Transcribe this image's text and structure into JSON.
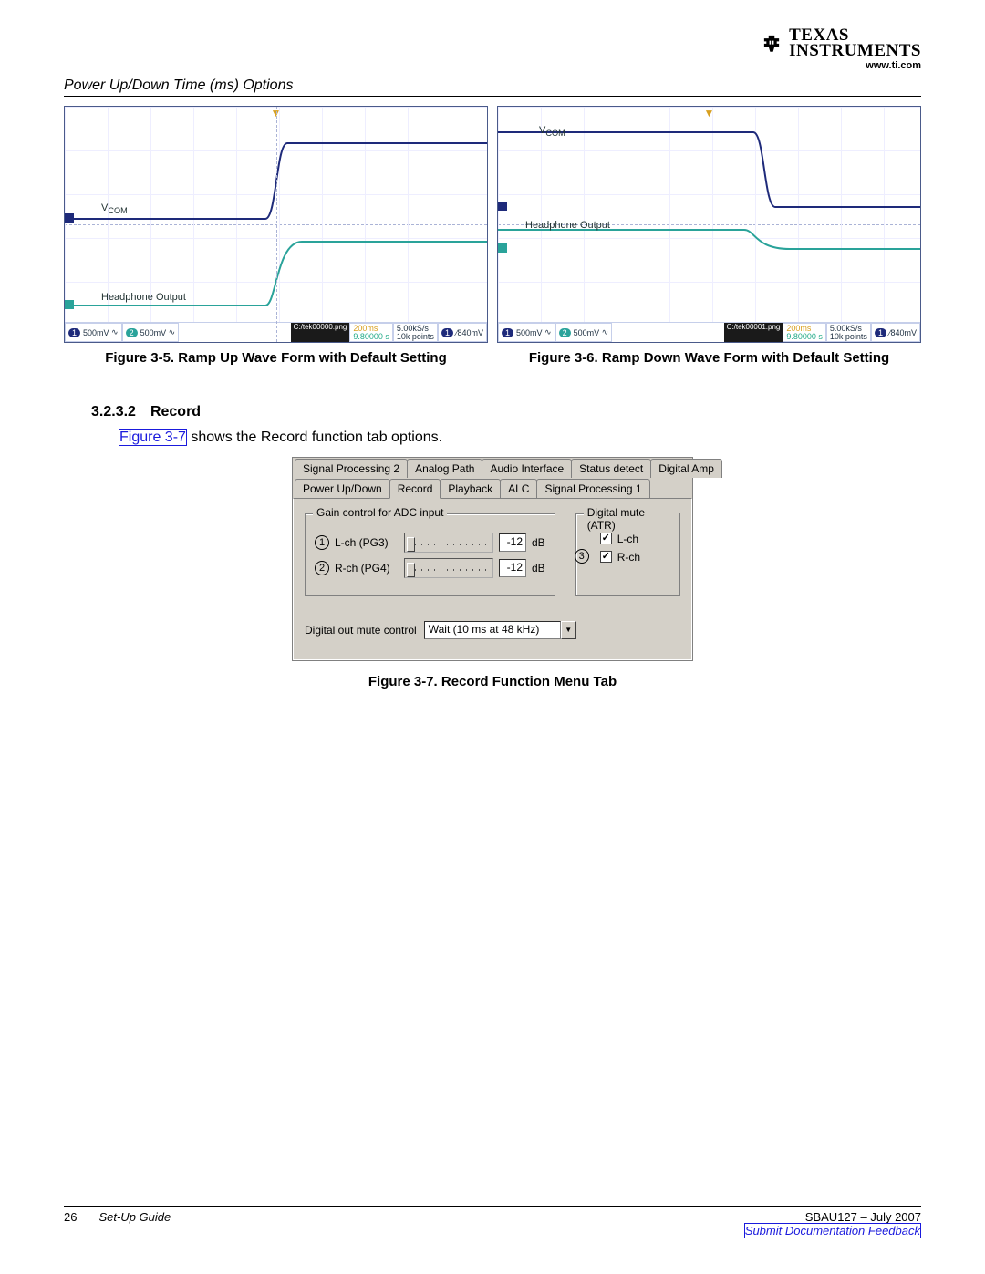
{
  "logo": {
    "line1": "TEXAS",
    "line2": "INSTRUMENTS",
    "url": "www.ti.com"
  },
  "section_header": "Power Up/Down Time (ms) Options",
  "scopes": {
    "left": {
      "vcom_label": "V",
      "vcom_sub": "COM",
      "hp_label": "Headphone Output",
      "file": "C:/tek00000.png",
      "info1": "500mV",
      "info2": "500mV",
      "tinfo_a": "200ms",
      "tinfo_b": "9.80000 s",
      "tinfo_c": "5.00kS/s",
      "tinfo_d": "10k points",
      "trig": "840mV"
    },
    "right": {
      "vcom_label": "V",
      "vcom_sub": "COM",
      "hp_label": "Headphone Output",
      "file": "C:/tek00001.png",
      "info1": "500mV",
      "info2": "500mV",
      "tinfo_a": "200ms",
      "tinfo_b": "9.80000 s",
      "tinfo_c": "5.00kS/s",
      "tinfo_d": "10k points",
      "trig": "840mV"
    }
  },
  "fig5": "Figure 3-5. Ramp Up Wave Form with Default Setting",
  "fig6": "Figure 3-6. Ramp Down Wave Form with Default Setting",
  "sec": {
    "num": "3.2.3.2",
    "title": "Record"
  },
  "body": {
    "link": "Figure 3-7",
    "rest": " shows the Record function tab options."
  },
  "gui": {
    "tabrow1": [
      "Signal Processing 2",
      "Analog Path",
      "Audio Interface",
      "Status detect",
      "Digital Amp"
    ],
    "tabrow2": [
      "Power Up/Down",
      "Record",
      "Playback",
      "ALC",
      "Signal Processing 1"
    ],
    "active": "Record",
    "gain_legend": "Gain control for ADC input",
    "lch": "L-ch  (PG3)",
    "rch": "R-ch  (PG4)",
    "lval": "-12",
    "rval": "-12",
    "unit": "dB",
    "mute_legend": "Digital mute (ATR)",
    "mlch": "L-ch",
    "mrch": "R-ch",
    "domc": "Digital out mute control",
    "domc_val": "Wait (10 ms at 48 kHz)"
  },
  "fig7": "Figure 3-7. Record Function Menu Tab",
  "footer": {
    "page": "26",
    "guide": "Set-Up Guide",
    "doc": "SBAU127 – July 2007",
    "feedback": "Submit Documentation Feedback"
  }
}
